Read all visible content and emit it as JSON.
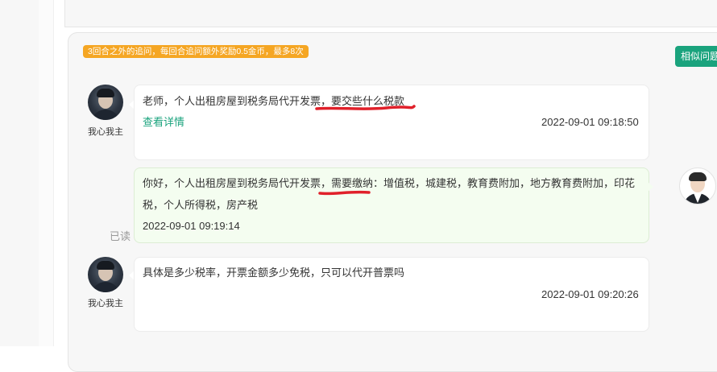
{
  "panel": {
    "notice": "3回合之外的追问，每回合追问额外奖励0.5金币，最多8次",
    "similar_button": "相似问题"
  },
  "messages": [
    {
      "user": "我心我主",
      "text_a": "老师，个人出租房屋到税务局代开发票，",
      "text_b": "要交些什么税款",
      "link": "查看详情",
      "time": "2022-09-01 09:18:50"
    },
    {
      "line1_a": "你好，个人出租房屋到税务局代开发票，",
      "line1_b": "需要缴纳",
      "line1_c": "：增值税，城建税，教育费附加，地方教育费附加，印花",
      "line2": "税，个人所得税，房产税",
      "time": "2022-09-01 09:19:14",
      "read": "已读"
    },
    {
      "user": "我心我主",
      "text": "具体是多少税率，开票金额多少免税，只可以代开普票吗",
      "time": "2022-09-01 09:20:26"
    }
  ],
  "colors": {
    "accent_green": "#1aa37d",
    "notice_orange": "#f5a623",
    "annotation_red": "#e0202a"
  }
}
